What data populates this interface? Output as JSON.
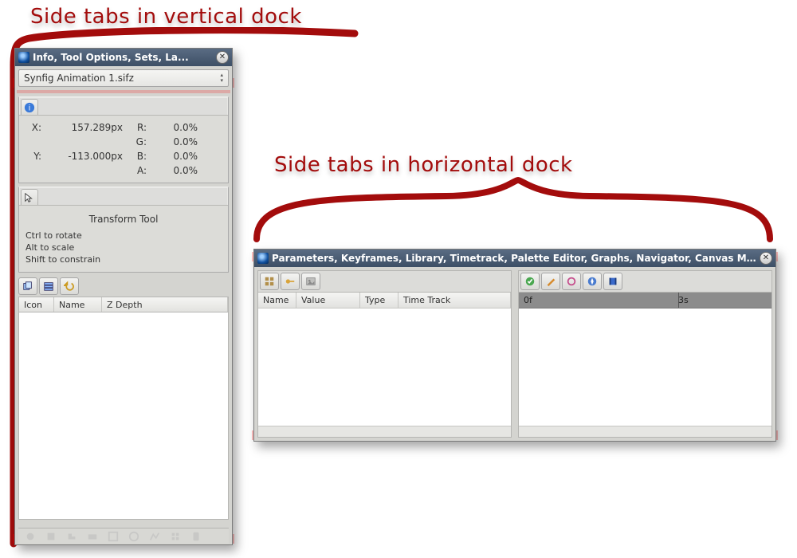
{
  "annotations": {
    "vertical_label": "Side tabs in vertical dock",
    "horizontal_label": "Side tabs in horizontal dock"
  },
  "vertical_dock": {
    "title": "Info, Tool Options, Sets, La...",
    "file_selector": "Synfig Animation 1.sifz",
    "info_panel": {
      "x_label": "X:",
      "x_value": "157.289px",
      "y_label": "Y:",
      "y_value": "-113.000px",
      "channels": [
        {
          "label": "R:",
          "value": "0.0%"
        },
        {
          "label": "G:",
          "value": "0.0%"
        },
        {
          "label": "B:",
          "value": "0.0%"
        },
        {
          "label": "A:",
          "value": "0.0%"
        }
      ]
    },
    "tool_options": {
      "title": "Transform Tool",
      "hints": [
        "Ctrl to rotate",
        "Alt to scale",
        "Shift to constrain"
      ]
    },
    "layers_columns": [
      "Icon",
      "Name",
      "Z Depth"
    ]
  },
  "horizontal_dock": {
    "title": "Parameters, Keyframes, Library, Timetrack, Palette Editor, Graphs, Navigator, Canvas M...",
    "left_columns": [
      "Name",
      "Value",
      "Type",
      "Time Track"
    ],
    "time_ticks": [
      "0f",
      "3s"
    ]
  }
}
